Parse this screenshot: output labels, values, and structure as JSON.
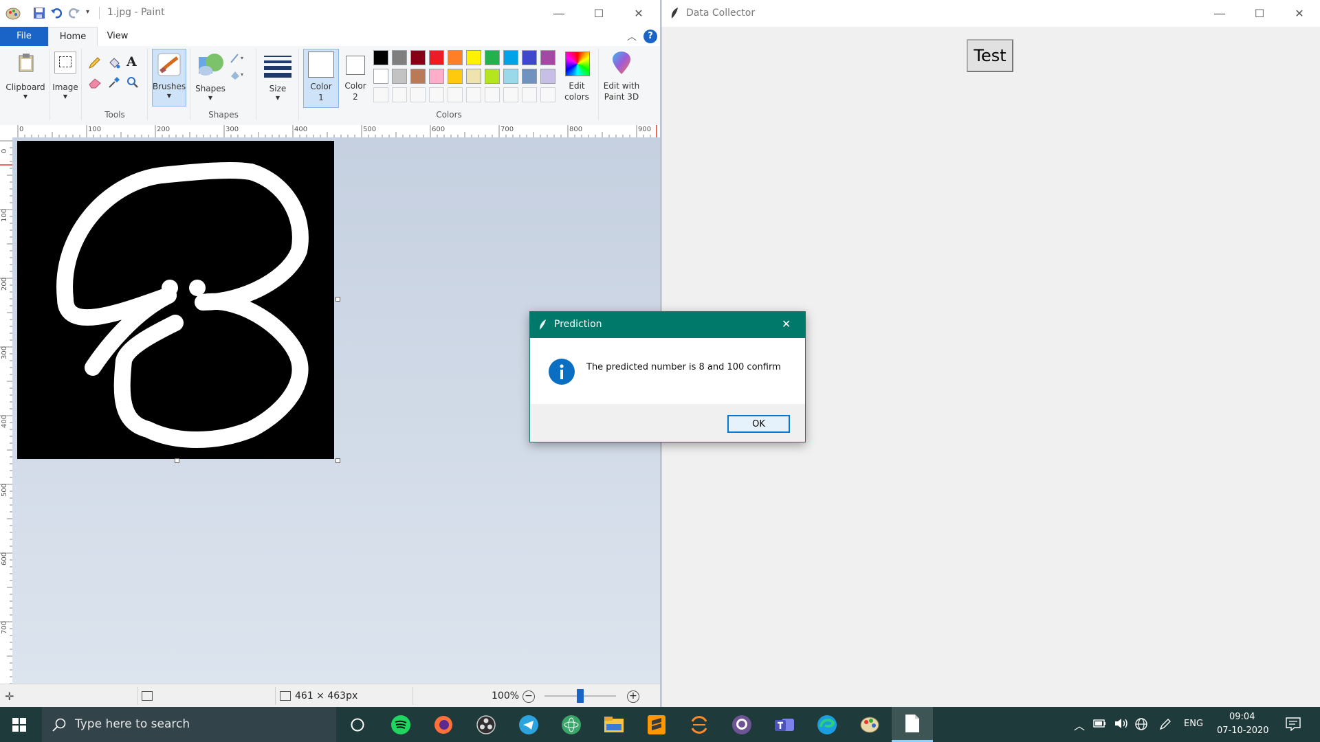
{
  "paint": {
    "title": "1.jpg - Paint",
    "tabs": {
      "file": "File",
      "home": "Home",
      "view": "View"
    },
    "ribbon": {
      "clipboard": "Clipboard",
      "image": "Image",
      "tools_group": "Tools",
      "brushes": "Brushes",
      "shapes": "Shapes",
      "shapes_group": "Shapes",
      "size": "Size",
      "color1": [
        "Color",
        "1"
      ],
      "color2": [
        "Color",
        "2"
      ],
      "colors_group": "Colors",
      "edit_colors": [
        "Edit",
        "colors"
      ],
      "edit_paint3d": [
        "Edit with",
        "Paint 3D"
      ]
    },
    "palette_row1": [
      "#000000",
      "#7f7f7f",
      "#880015",
      "#ed1c24",
      "#ff7f27",
      "#fff200",
      "#22b14c",
      "#00a2e8",
      "#3f48cc",
      "#a349a4"
    ],
    "palette_row2": [
      "#ffffff",
      "#c3c3c3",
      "#b97a57",
      "#ffaec9",
      "#ffc90e",
      "#efe4b0",
      "#b5e61d",
      "#99d9ea",
      "#7092be",
      "#c8bfe7"
    ],
    "ruler_top": [
      "0",
      "100",
      "200",
      "300",
      "400",
      "500",
      "600",
      "700",
      "800",
      "900"
    ],
    "ruler_left": [
      "0",
      "100",
      "200",
      "300",
      "400",
      "500",
      "600",
      "700"
    ],
    "status": {
      "dimensions": "461 × 463px",
      "zoom": "100%"
    }
  },
  "data_collector": {
    "title": "Data Collector",
    "test_button": "Test"
  },
  "dialog": {
    "title": "Prediction",
    "message": "The predicted number is 8 and 100 confirm",
    "ok": "OK"
  },
  "taskbar": {
    "search_placeholder": "Type here to search",
    "language": "ENG",
    "time": "09:04",
    "date": "07-10-2020"
  }
}
